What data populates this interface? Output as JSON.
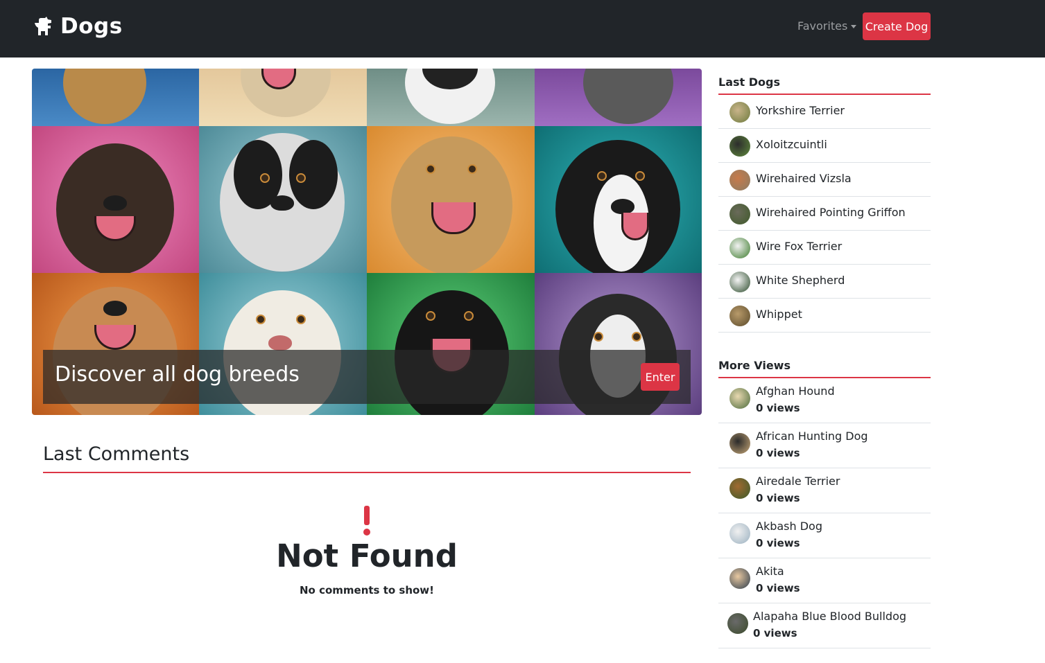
{
  "navbar": {
    "brand": "Dogs",
    "favorites_label": "Favorites",
    "create_label": "Create Dog"
  },
  "hero": {
    "title": "Discover all dog breeds",
    "enter_label": "Enter"
  },
  "comments": {
    "title": "Last Comments",
    "empty_title": "Not Found",
    "empty_subtitle": "No comments to show!"
  },
  "last_dogs": {
    "title": "Last Dogs",
    "items": [
      {
        "name": "Yorkshire Terrier"
      },
      {
        "name": "Xoloitzcuintli"
      },
      {
        "name": "Wirehaired Vizsla"
      },
      {
        "name": "Wirehaired Pointing Griffon"
      },
      {
        "name": "Wire Fox Terrier"
      },
      {
        "name": "White Shepherd"
      },
      {
        "name": "Whippet"
      }
    ]
  },
  "more_views": {
    "title": "More Views",
    "items": [
      {
        "name": "Afghan Hound",
        "views": "0 views"
      },
      {
        "name": "African Hunting Dog",
        "views": "0 views"
      },
      {
        "name": "Airedale Terrier",
        "views": "0 views"
      },
      {
        "name": "Akbash Dog",
        "views": "0 views"
      },
      {
        "name": "Akita",
        "views": "0 views"
      },
      {
        "name": "Alapaha Blue Blood Bulldog",
        "views": "0 views"
      }
    ]
  },
  "colors": {
    "navbar": "#212529",
    "accent": "#dc3545"
  }
}
